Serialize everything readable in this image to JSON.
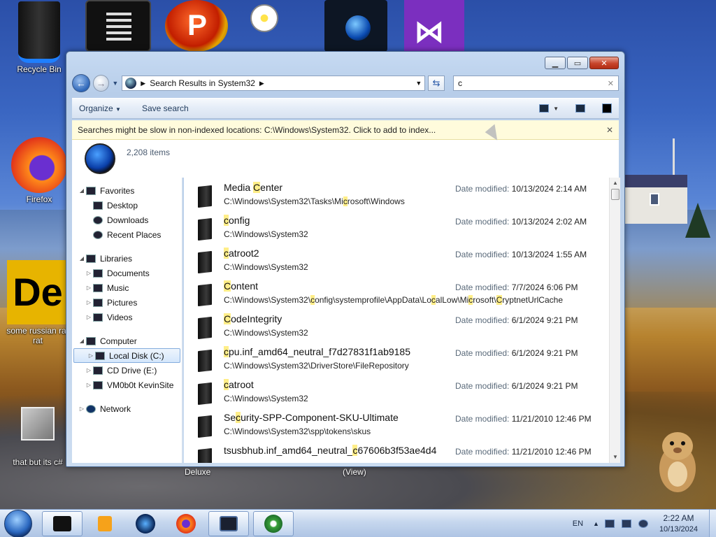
{
  "desktop": {
    "icons": [
      {
        "label": "Recycle Bin"
      },
      {
        "label": "Firefox"
      },
      {
        "label": "some russian rar rat"
      },
      {
        "label": "that but its c#"
      }
    ],
    "partial_labels": {
      "left": "Deluxe",
      "right": "(View)"
    }
  },
  "window": {
    "address": {
      "path": "Search Results in System32"
    },
    "search": {
      "value": "c"
    },
    "command_bar": {
      "organize": "Organize",
      "save_search": "Save search"
    },
    "infobar": {
      "text": "Searches might be slow in non-indexed locations: C:\\Windows\\System32. Click to add to index..."
    },
    "summary": {
      "count": "2,208 items"
    },
    "nav": {
      "favorites": "Favorites",
      "desktop": "Desktop",
      "downloads": "Downloads",
      "recent": "Recent Places",
      "libraries": "Libraries",
      "documents": "Documents",
      "music": "Music",
      "pictures": "Pictures",
      "videos": "Videos",
      "computer": "Computer",
      "local_disk": "Local Disk (C:)",
      "cd_drive": "CD Drive (E:)",
      "share": "VM0b0t KevinSite",
      "network": "Network"
    },
    "date_label": "Date modified:",
    "results": [
      {
        "name": "Media Center",
        "path": "C:\\Windows\\System32\\Tasks\\Microsoft\\Windows",
        "date": "10/13/2024 2:14 AM"
      },
      {
        "name": "config",
        "path": "C:\\Windows\\System32",
        "date": "10/13/2024 2:02 AM"
      },
      {
        "name": "catroot2",
        "path": "C:\\Windows\\System32",
        "date": "10/13/2024 1:55 AM"
      },
      {
        "name": "Content",
        "path": "C:\\Windows\\System32\\config\\systemprofile\\AppData\\LocalLow\\Microsoft\\CryptnetUrlCache",
        "date": "7/7/2024 6:06 PM"
      },
      {
        "name": "CodeIntegrity",
        "path": "C:\\Windows\\System32",
        "date": "6/1/2024 9:21 PM"
      },
      {
        "name": "cpu.inf_amd64_neutral_f7d27831f1ab9185",
        "path": "C:\\Windows\\System32\\DriverStore\\FileRepository",
        "date": "6/1/2024 9:21 PM"
      },
      {
        "name": "catroot",
        "path": "C:\\Windows\\System32",
        "date": "6/1/2024 9:21 PM"
      },
      {
        "name": "Security-SPP-Component-SKU-Ultimate",
        "path": "C:\\Windows\\System32\\spp\\tokens\\skus",
        "date": "11/21/2010 12:46 PM"
      },
      {
        "name": "tsusbhub.inf_amd64_neutral_c67606b3f53ae4d4",
        "path": "",
        "date": "11/21/2010 12:46 PM"
      }
    ]
  },
  "taskbar": {
    "lang": "EN",
    "time": "2:22 AM",
    "date": "10/13/2024"
  },
  "colors": {
    "highlight": "#ffee88",
    "accent": "#2b68c0"
  }
}
